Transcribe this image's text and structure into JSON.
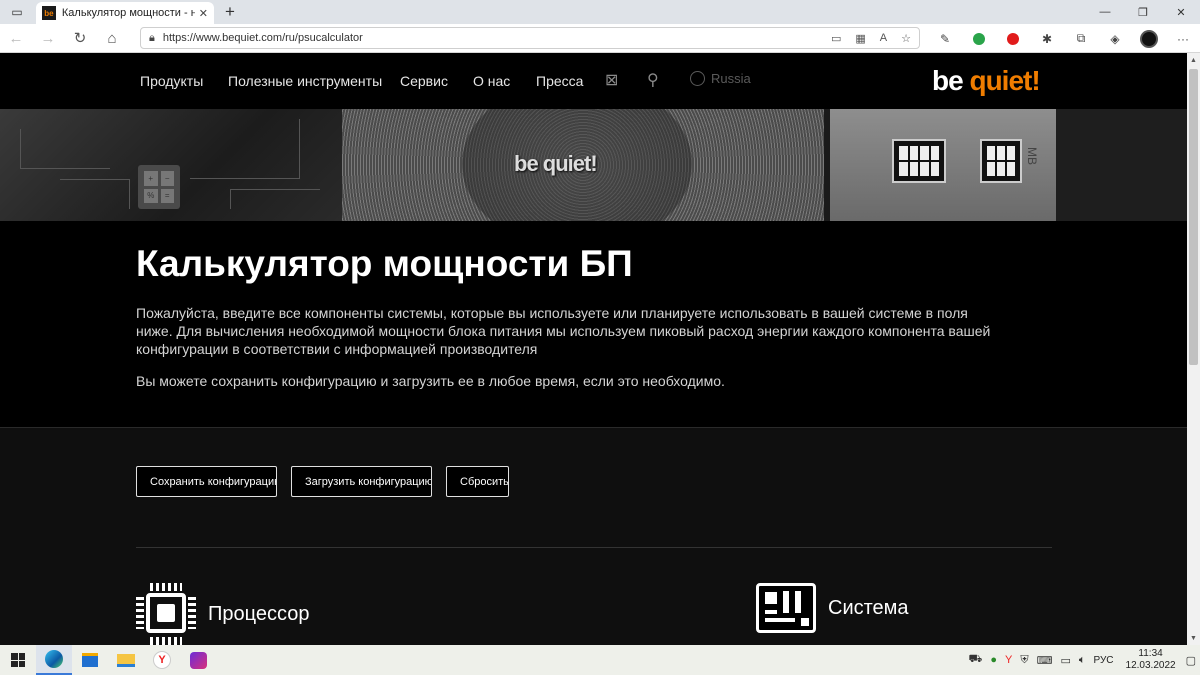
{
  "browser": {
    "tab_title": "Калькулятор мощности - найди",
    "tab_favicon": "be",
    "url": "https://www.bequiet.com/ru/psucalculator",
    "window_controls": [
      "—",
      "❐",
      "✕"
    ]
  },
  "site_nav": {
    "items": [
      "Продукты",
      "Полезные инструменты",
      "Сервис",
      "О нас",
      "Пресса"
    ],
    "mail_icon": "mail-icon",
    "search_icon": "search-icon",
    "language": "Russia",
    "logo_be": "be",
    "logo_quiet": "quiet!"
  },
  "hero": {
    "mesh_logo": "be quiet!",
    "mb_label": "MB",
    "calc_symbols": [
      "+",
      "−",
      "%",
      "="
    ]
  },
  "intro": {
    "title": "Калькулятор мощности БП",
    "paragraph1": "Пожалуйста, введите все компоненты системы, которые вы используете или планируете использовать в вашей системе в поля ниже. Для вычисления необходимой мощности блока питания мы используем пиковый расход энергии каждого компонента вашей конфигурации в соответствии с информацией производителя",
    "paragraph2": "Вы можете сохранить конфигурацию и загрузить ее в любое время, если это необходимо."
  },
  "actions": {
    "save": "Сохранить конфигурацию",
    "load": "Загрузить конфигурацию",
    "reset": "Сбросить"
  },
  "sections": {
    "cpu": "Процессор",
    "system": "Система"
  },
  "taskbar": {
    "language": "РУС",
    "time": "11:34",
    "date": "12.03.2022"
  },
  "colors": {
    "accent": "#f07d00",
    "background": "#000000"
  }
}
